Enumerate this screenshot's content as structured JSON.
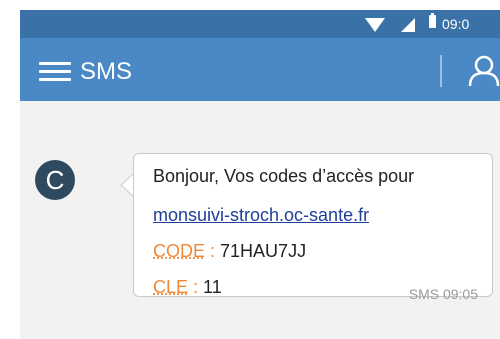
{
  "status_bar": {
    "time": "09:0"
  },
  "app_bar": {
    "title": "SMS"
  },
  "contact": {
    "initial": "C"
  },
  "message": {
    "line1": "Bonjour, Vos codes d’accès pour",
    "link": "monsuivi-stroch.oc-sante.fr",
    "code_label": "CODE",
    "code_sep": " : ",
    "code_value": "71HAU7JJ",
    "cle_label": "CLE",
    "cle_sep": " : ",
    "cle_value": "11",
    "meta": "SMS 09:05"
  },
  "icons": [
    "wifi-icon",
    "signal-icon",
    "battery-icon",
    "menu-icon",
    "user-icon"
  ],
  "colors": {
    "status_bar": "#3a72a8",
    "app_bar": "#4a89c5",
    "avatar": "#2f4a5f",
    "link": "#1f3f9a",
    "key_label": "#f0883a"
  }
}
